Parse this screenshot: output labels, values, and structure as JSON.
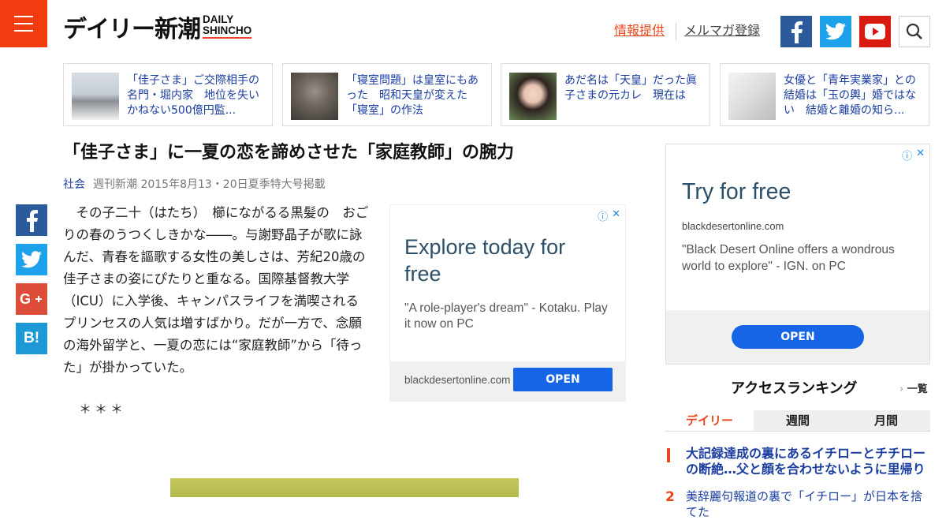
{
  "header": {
    "logo_main": "デイリー新潮",
    "logo_sub_line1": "DAILY",
    "logo_sub_line2": "SHINCHO",
    "link_info": "情報提供",
    "link_mail": "メルマガ登録"
  },
  "related": [
    {
      "text": "「佳子さま」ご交際相手の名門・堀内家　地位を失いかねない500億円監..."
    },
    {
      "text": "「寝室問題」は皇室にもあった　昭和天皇が変えた「寝室」の作法"
    },
    {
      "text": "あだ名は「天皇」だった眞子さまの元カレ　現在は"
    },
    {
      "text": "女優と「青年実業家」との結婚は「玉の輿」婚ではない　結婚と離婚の知ら..."
    }
  ],
  "article": {
    "title": "「佳子さま」に一夏の恋を諦めさせた「家庭教師」の腕力",
    "category": "社会",
    "pubinfo": "週刊新潮 2015年8月13・20日夏季特大号掲載",
    "body": "その子二十（はたち）　櫛にながるる黒髪の　おごりの春のうつくしきかな――。与謝野晶子が歌に詠んだ、青春を謳歌する女性の美しさは、芳紀20歳の佳子さまの姿にぴたりと重なる。国際基督教大学（ICU）に入学後、キャンパスライフを満喫されるプリンセスの人気は増すばかり。だが一方で、念願の海外留学と、一夏の恋には“家庭教師”から「待った」が掛かっていた。",
    "separator": "＊＊＊"
  },
  "ad1": {
    "headline": "Explore today for free",
    "desc": "\"A role-player's dream\" - Kotaku. Play it now on PC",
    "domain": "blackdesertonline.com",
    "cta": "OPEN"
  },
  "ad2": {
    "headline": "Try for free",
    "domain": "blackdesertonline.com",
    "desc": "\"Black Desert Online offers a wondrous world to explore\" - IGN. on PC",
    "cta": "OPEN"
  },
  "ranking": {
    "title": "アクセスランキング",
    "all_link": "一覧",
    "tabs": [
      "デイリー",
      "週間",
      "月間"
    ],
    "items": [
      {
        "num": "1",
        "text": "大記録達成の裏にあるイチローとチチローの断絶…父と顔を合わせないように里帰り"
      },
      {
        "num": "2",
        "text": "美辞麗句報道の裏で「イチロー」が日本を捨てた"
      }
    ]
  },
  "colors": {
    "brand": "#f03c0f",
    "link": "#1a3da0",
    "facebook": "#2c5b9b",
    "twitter": "#1ea1eb",
    "youtube": "#d81a10",
    "ad_button": "#1565e6"
  }
}
